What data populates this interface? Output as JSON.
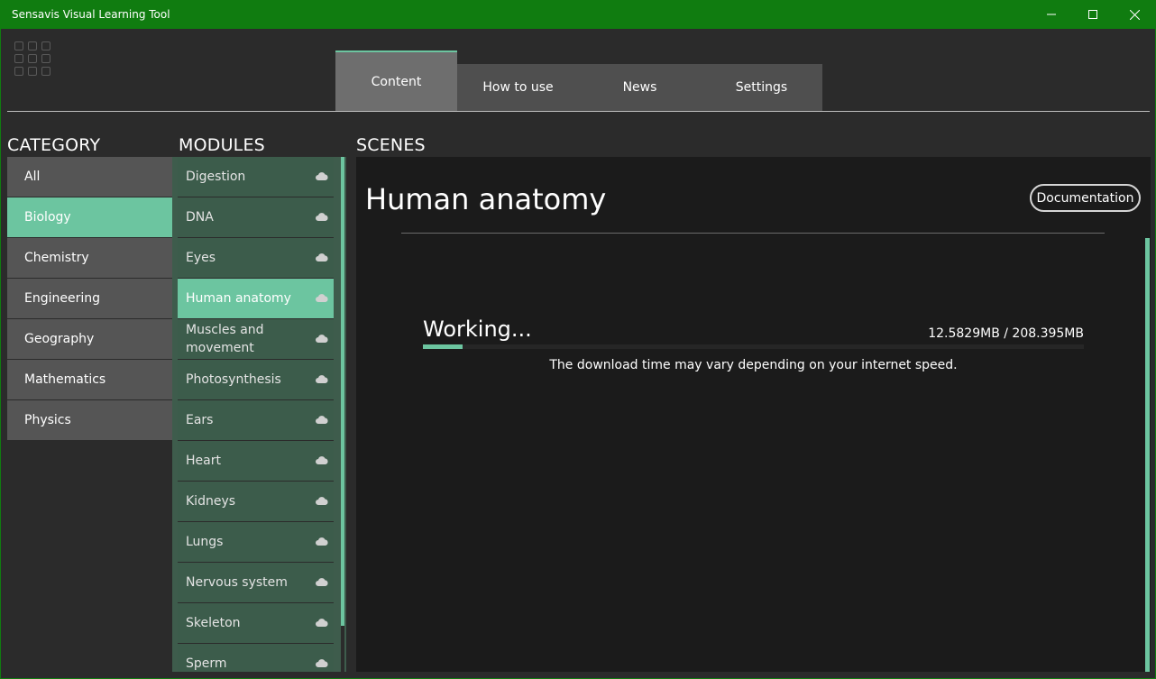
{
  "window": {
    "title": "Sensavis Visual Learning Tool",
    "controls": [
      "minimize-icon",
      "maximize-icon",
      "close-icon"
    ]
  },
  "tabs": [
    {
      "label": "Content",
      "active": true
    },
    {
      "label": "How to use",
      "active": false
    },
    {
      "label": "News",
      "active": false
    },
    {
      "label": "Settings",
      "active": false
    }
  ],
  "category": {
    "heading": "CATEGORY",
    "items": [
      {
        "label": "All",
        "active": false
      },
      {
        "label": "Biology",
        "active": true
      },
      {
        "label": "Chemistry",
        "active": false
      },
      {
        "label": "Engineering",
        "active": false
      },
      {
        "label": "Geography",
        "active": false
      },
      {
        "label": "Mathematics",
        "active": false
      },
      {
        "label": "Physics",
        "active": false
      }
    ]
  },
  "modules": {
    "heading": "MODULES",
    "items": [
      {
        "label": "Digestion",
        "active": false
      },
      {
        "label": "DNA",
        "active": false
      },
      {
        "label": "Eyes",
        "active": false
      },
      {
        "label": "Human anatomy",
        "active": true
      },
      {
        "label": "Muscles and movement",
        "active": false
      },
      {
        "label": "Photosynthesis",
        "active": false
      },
      {
        "label": "Ears",
        "active": false
      },
      {
        "label": "Heart",
        "active": false
      },
      {
        "label": "Kidneys",
        "active": false
      },
      {
        "label": "Lungs",
        "active": false
      },
      {
        "label": "Nervous system",
        "active": false
      },
      {
        "label": "Skeleton",
        "active": false
      },
      {
        "label": "Sperm",
        "active": false
      }
    ]
  },
  "scenes": {
    "heading": "SCENES",
    "title": "Human anatomy",
    "documentation_label": "Documentation",
    "status": "Working...",
    "downloaded": "12.5829MB / 208.395MB",
    "progress": 0.06,
    "note": "The download time may vary depending on your internet speed."
  },
  "colors": {
    "titlebar": "#107c10",
    "accent": "#6cc5a0",
    "background": "#2b2b2b",
    "panel": "#1b1b1b"
  }
}
